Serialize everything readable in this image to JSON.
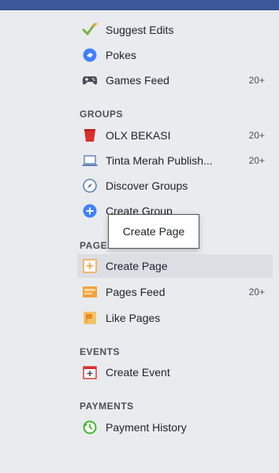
{
  "top_items": [
    {
      "label": "Suggest Edits",
      "icon": "checkmark-pencil-icon"
    },
    {
      "label": "Pokes",
      "icon": "poke-hand-icon"
    },
    {
      "label": "Games Feed",
      "icon": "gamepad-icon",
      "count": "20+"
    }
  ],
  "groups": {
    "header": "GROUPS",
    "items": [
      {
        "label": "OLX BEKASI",
        "icon": "group-cup-icon",
        "count": "20+"
      },
      {
        "label": "Tinta Merah Publish...",
        "icon": "group-laptop-icon",
        "count": "20+"
      },
      {
        "label": "Discover Groups",
        "icon": "compass-icon"
      },
      {
        "label": "Create Group",
        "icon": "plus-circle-icon"
      }
    ]
  },
  "pages": {
    "header": "PAGES",
    "items": [
      {
        "label": "Create Page",
        "icon": "create-page-icon"
      },
      {
        "label": "Pages Feed",
        "icon": "pages-feed-icon",
        "count": "20+"
      },
      {
        "label": "Like Pages",
        "icon": "flag-icon"
      }
    ]
  },
  "events": {
    "header": "EVENTS",
    "items": [
      {
        "label": "Create Event",
        "icon": "calendar-plus-icon"
      }
    ]
  },
  "payments": {
    "header": "PAYMENTS",
    "items": [
      {
        "label": "Payment History",
        "icon": "payment-history-icon"
      }
    ]
  },
  "tooltip": {
    "text": "Create Page"
  },
  "colors": {
    "brand": "#3b5998",
    "background": "#e9ebee",
    "hover": "#dcdee3"
  }
}
